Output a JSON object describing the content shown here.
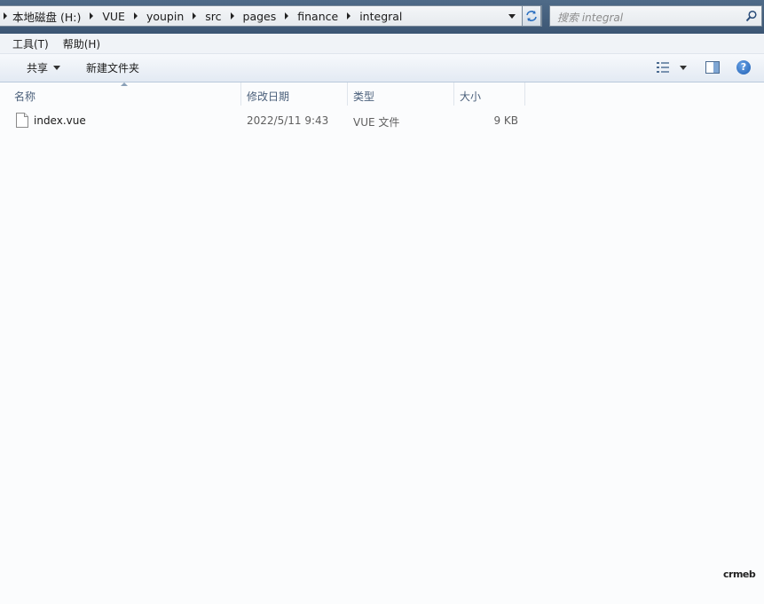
{
  "breadcrumb": [
    "本地磁盘 (H:)",
    "VUE",
    "youpin",
    "src",
    "pages",
    "finance",
    "integral"
  ],
  "search": {
    "placeholder": "搜索 integral"
  },
  "menu": {
    "tools": "工具(T)",
    "help": "帮助(H)"
  },
  "toolbar": {
    "share": "共享",
    "new_folder": "新建文件夹"
  },
  "columns": {
    "name": "名称",
    "date": "修改日期",
    "type": "类型",
    "size": "大小"
  },
  "files": [
    {
      "name": "index.vue",
      "date": "2022/5/11 9:43",
      "type": "VUE 文件",
      "size": "9 KB",
      "icon": "file-icon"
    }
  ],
  "watermark": "crmeb",
  "icons": [
    "refresh-icon",
    "search-icon",
    "views-icon",
    "preview-pane-icon",
    "help-icon",
    "file-icon"
  ]
}
